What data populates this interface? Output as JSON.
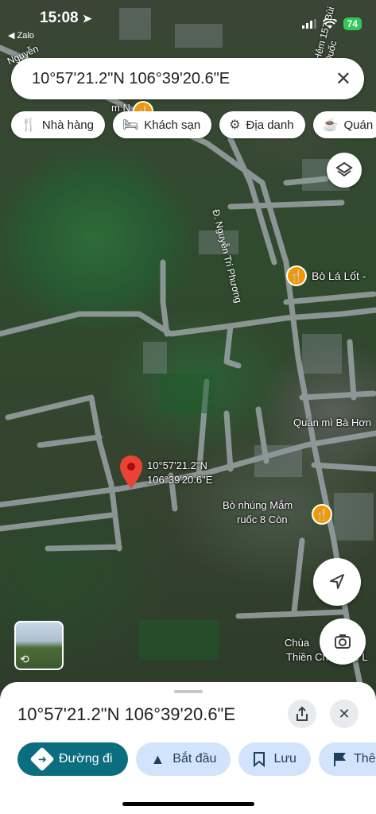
{
  "status_bar": {
    "time": "15:08",
    "back_app": "◀ Zalo",
    "battery": "74"
  },
  "search": {
    "value": "10°57'21.2\"N 106°39'20.6\"E"
  },
  "chips": [
    {
      "label": "Nhà hàng",
      "icon": "fork-knife-icon"
    },
    {
      "label": "Khách sạn",
      "icon": "bed-icon"
    },
    {
      "label": "Địa danh",
      "icon": "landmark-icon"
    },
    {
      "label": "Quán",
      "icon": "coffee-icon"
    }
  ],
  "map_labels": {
    "street_nguyen_tri_phuong": "Đ. Nguyễn Tri Phương",
    "street_top_left": "Nguyễn",
    "street_top_right": "Hẻm 157 Bùi Quốc",
    "poi_bo_la_lot": "Bò Lá Lốt -",
    "poi_quan_mi": "Quán mì Bà Hơn",
    "poi_bo_nhung_line1": "Bò nhúng Mắm",
    "poi_bo_nhung_line2": "ruốc 8 Còn",
    "poi_chua_line1": "Chùa",
    "poi_chua_line2": "Thiền Ch...em c L",
    "poi_top_partial": "m N"
  },
  "pin": {
    "lat": "10°57'21.2\"N",
    "lng": "106°39'20.6\"E"
  },
  "sheet": {
    "title": "10°57'21.2\"N 106°39'20.6\"E",
    "actions": {
      "directions": "Đường đi",
      "start": "Bắt đầu",
      "save": "Lưu",
      "more": "Thê"
    }
  },
  "colors": {
    "accent": "#0b6e7e",
    "poi": "#f29900",
    "pin": "#ea4335"
  }
}
